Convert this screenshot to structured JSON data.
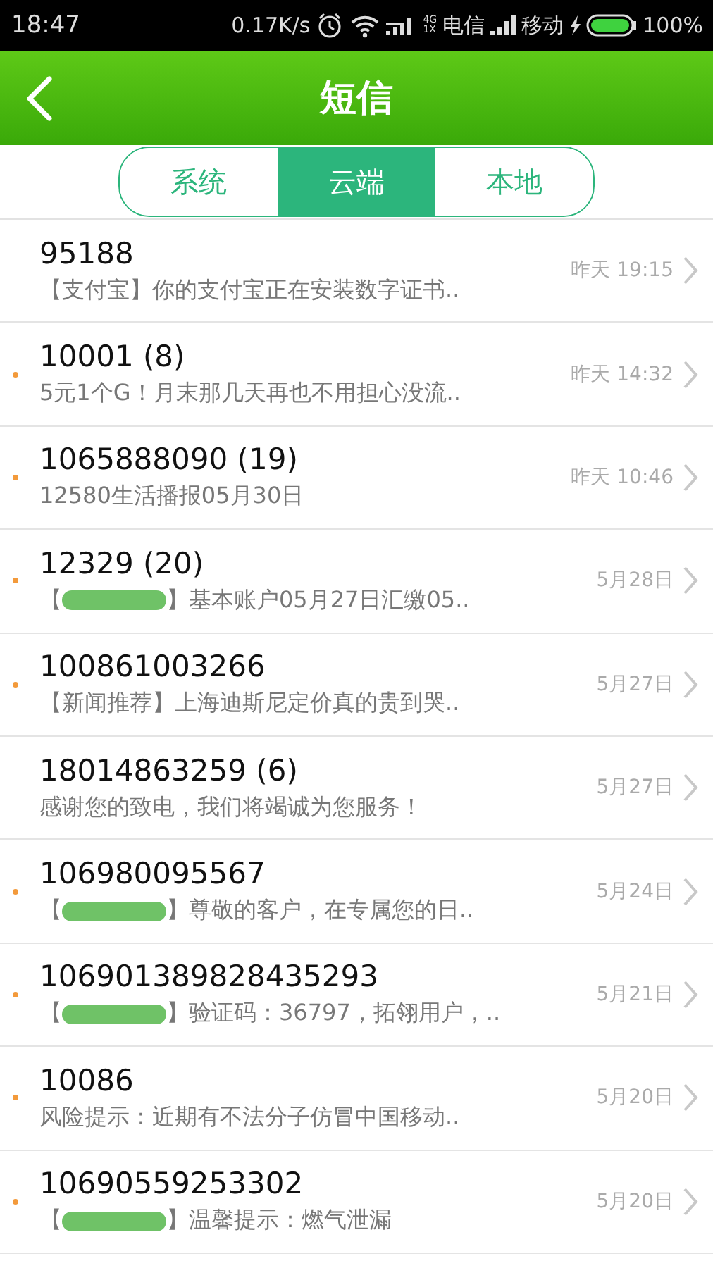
{
  "status_bar": {
    "time": "18:47",
    "speed": "0.17K/s",
    "network_badge_top": "4G",
    "network_badge_bottom": "1X",
    "carrier_1": "电信",
    "carrier_2": "移动",
    "battery": "100%"
  },
  "header": {
    "title": "短信"
  },
  "tabs": [
    {
      "label": "系统",
      "selected": false
    },
    {
      "label": "云端",
      "selected": true
    },
    {
      "label": "本地",
      "selected": false
    }
  ],
  "messages": [
    {
      "sender": "95188",
      "unread": false,
      "preview": "【支付宝】你的支付宝正在安装数字证书..",
      "time": "昨天 19:15"
    },
    {
      "sender": "10001 (8)",
      "unread": true,
      "preview": "5元1个G！月末那几天再也不用担心没流..",
      "time": "昨天 14:32"
    },
    {
      "sender": "1065888090 (19)",
      "unread": true,
      "preview": "12580生活播报05月30日",
      "time": "昨天 10:46"
    },
    {
      "sender": "12329 (20)",
      "unread": true,
      "preview_start": "【",
      "redacted": true,
      "preview": "】基本账户05月27日汇缴05..",
      "time": "5月28日"
    },
    {
      "sender": "100861003266",
      "unread": true,
      "preview": "【新闻推荐】上海迪斯尼定价真的贵到哭..",
      "time": "5月27日"
    },
    {
      "sender": "18014863259 (6)",
      "unread": false,
      "preview": "感谢您的致电，我们将竭诚为您服务！",
      "time": "5月27日"
    },
    {
      "sender": "106980095567",
      "unread": true,
      "preview_start": "【",
      "redacted": true,
      "preview": "】尊敬的客户，在专属您的日..",
      "time": "5月24日"
    },
    {
      "sender": "106901389828435293",
      "unread": true,
      "preview_start": "【",
      "redacted": true,
      "preview": "】验证码：36797，拓翎用户，..",
      "time": "5月21日"
    },
    {
      "sender": "10086",
      "unread": true,
      "preview": "风险提示：近期有不法分子仿冒中国移动..",
      "time": "5月20日"
    },
    {
      "sender": "10690559253302",
      "unread": true,
      "preview_start": "【",
      "redacted": true,
      "preview": "】温馨提示：燃气泄漏",
      "time": "5月20日"
    }
  ]
}
